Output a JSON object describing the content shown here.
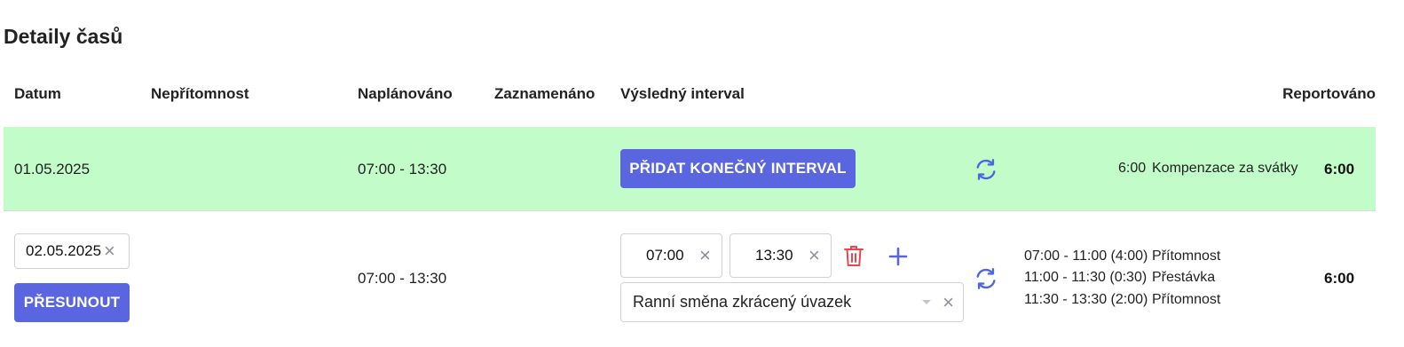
{
  "title": "Detaily časů",
  "headers": {
    "date": "Datum",
    "absence": "Nepřítomnost",
    "planned": "Naplánováno",
    "recorded": "Zaznamenáno",
    "result": "Výsledný interval",
    "reported": "Reportováno"
  },
  "rows": [
    {
      "date": "01.05.2025",
      "planned": "07:00 - 13:30",
      "add_button": "PŘIDAT KONEČNÝ INTERVAL",
      "details": [
        {
          "time": "6:00",
          "label": "Kompenzace za svátky"
        }
      ],
      "reported": "6:00",
      "background": "#c2fcc9"
    },
    {
      "date_value": "02.05.2025",
      "move_button": "PŘESUNOUT",
      "planned": "07:00 - 13:30",
      "from": "07:00",
      "to": "13:30",
      "shift": "Ranní směna zkrácený úvazek",
      "details": [
        {
          "time": "07:00 - 11:00 (4:00)",
          "label": "Přítomnost"
        },
        {
          "time": "11:00 - 11:30 (0:30)",
          "label": "Přestávka"
        },
        {
          "time": "11:30 - 13:30 (2:00)",
          "label": "Přítomnost"
        }
      ],
      "reported": "6:00"
    }
  ],
  "colors": {
    "accent": "#5a66e0",
    "delete": "#e5484d",
    "refresh": "#4c66e0"
  },
  "icons": [
    "refresh-icon",
    "trash-icon",
    "plus-icon",
    "close-icon",
    "chevron-down-icon"
  ]
}
